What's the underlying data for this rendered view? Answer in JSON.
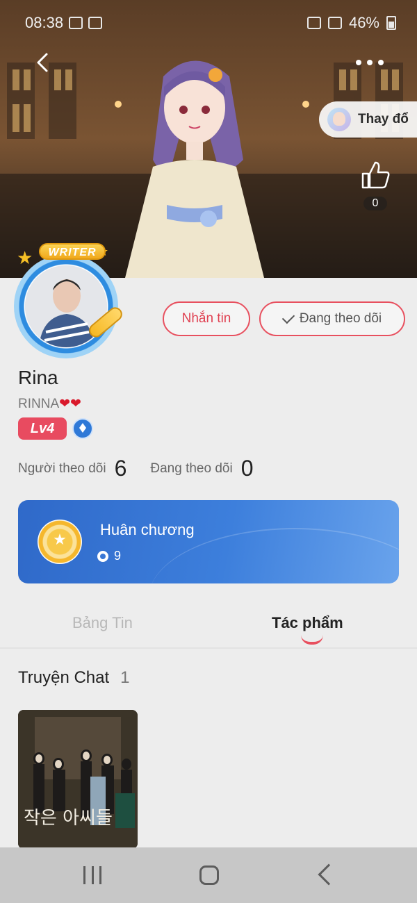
{
  "status_bar": {
    "time": "08:38",
    "battery": "46%"
  },
  "header": {
    "change_outfit_label": "Thay đổ",
    "like_count": "0"
  },
  "profile": {
    "badge_label": "WRITER",
    "name": "Rina",
    "username": "RINNA",
    "level_label": "Lv4",
    "message_button": "Nhắn tin",
    "following_button": "Đang theo dõi",
    "followers_label": "Người theo dõi",
    "followers_count": "6",
    "following_label": "Đang theo dõi",
    "following_count": "0"
  },
  "medal": {
    "title": "Huân chương",
    "count": "9"
  },
  "tabs": [
    {
      "label": "Bảng Tin",
      "active": false
    },
    {
      "label": "Tác phẩm",
      "active": true
    }
  ],
  "works": {
    "section_title": "Truyện Chat",
    "count": "1",
    "items": [
      {
        "poster_text": "작은 아씨들"
      }
    ]
  },
  "colors": {
    "accent": "#e8505f",
    "medal_card": "#3d7fdc",
    "level_badge": "#e84b60"
  }
}
